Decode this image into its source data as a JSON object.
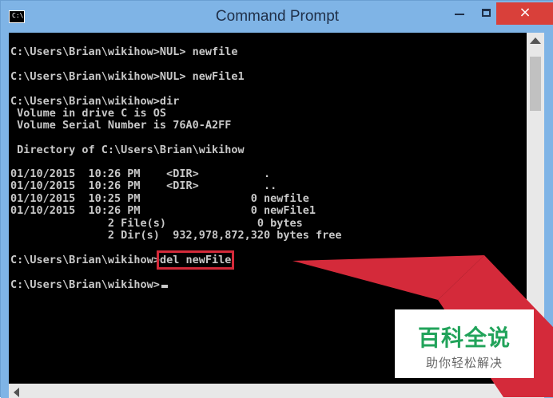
{
  "window": {
    "title": "Command Prompt",
    "icon_label": "C:\\",
    "controls": {
      "minimize": "minimize-icon",
      "maximize": "maximize-icon",
      "close": "×"
    }
  },
  "console": {
    "lines": [
      "C:\\Users\\Brian\\wikihow>NUL> newfile",
      "C:\\Users\\Brian\\wikihow>NUL> newFile1",
      "C:\\Users\\Brian\\wikihow>dir",
      " Volume in drive C is OS",
      " Volume Serial Number is 76A0-A2FF",
      " Directory of C:\\Users\\Brian\\wikihow",
      "01/10/2015  10:26 PM    <DIR>          .",
      "01/10/2015  10:26 PM    <DIR>          ..",
      "01/10/2015  10:25 PM                 0 newfile",
      "01/10/2015  10:26 PM                 0 newFile1",
      "               2 File(s)              0 bytes",
      "               2 Dir(s)  932,978,872,320 bytes free"
    ],
    "del_prompt": "C:\\Users\\Brian\\wikihow>",
    "del_command": "del newFile",
    "final_prompt": "C:\\Users\\Brian\\wikihow>"
  },
  "annotation": {
    "highlight_color": "#d42a3a",
    "arrow_color": "#d42a3a"
  },
  "watermark": {
    "title": "百科全说",
    "subtitle": "助你轻松解决",
    "title_color": "#21a35a"
  }
}
